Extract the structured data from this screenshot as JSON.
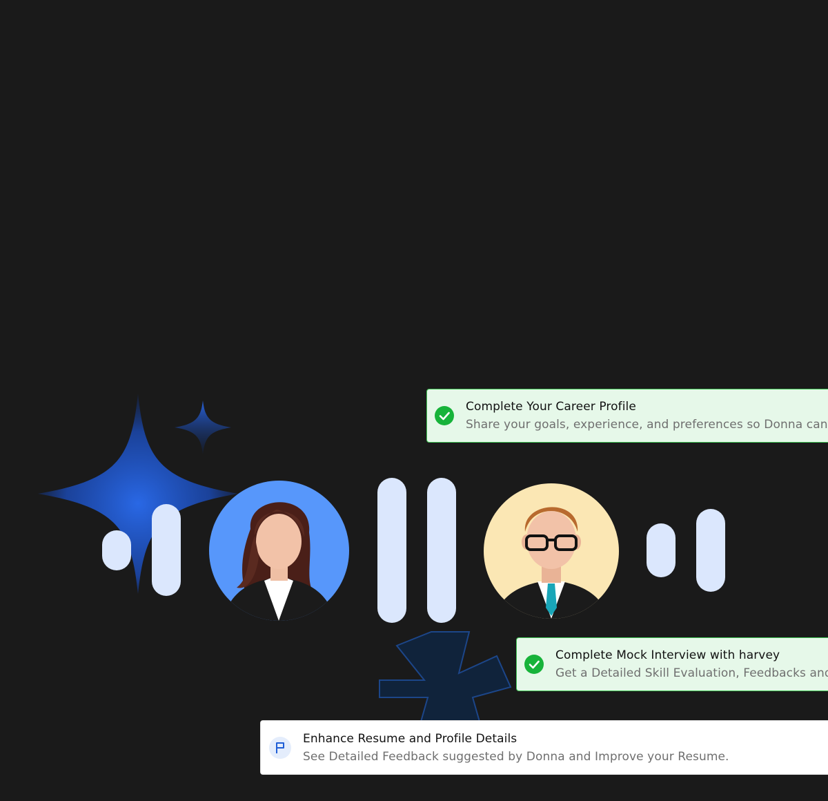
{
  "colors": {
    "background": "#1a1a1a",
    "bar": "#dbe7fd",
    "done_bg": "#e6f8e9",
    "done_border": "#3fc654",
    "check": "#17b33a",
    "accent_blue": "#1f5ed6"
  },
  "voice_levels": [
    0.3,
    0.7,
    1.0,
    1.0,
    0.4,
    0.6
  ],
  "avatars": [
    {
      "name": "female-interviewee-avatar",
      "bg": "#5797fb"
    },
    {
      "name": "male-interviewer-avatar",
      "bg": "#fbe7b4"
    }
  ],
  "tasks": [
    {
      "status": "completed",
      "icon": "check-icon",
      "title": "Complete Your Career Profile",
      "description": "Share your goals, experience, and preferences so Donna can perso"
    },
    {
      "status": "completed",
      "icon": "check-icon",
      "title": "Complete Mock Interview with harvey",
      "description": "Get a Detailed Skill Evaluation, Feedbacks and Imp"
    },
    {
      "status": "pending",
      "icon": "flag-icon",
      "title": "Enhance Resume and Profile Details",
      "description": "See Detailed Feedback suggested by Donna and Improve your Resume."
    }
  ]
}
